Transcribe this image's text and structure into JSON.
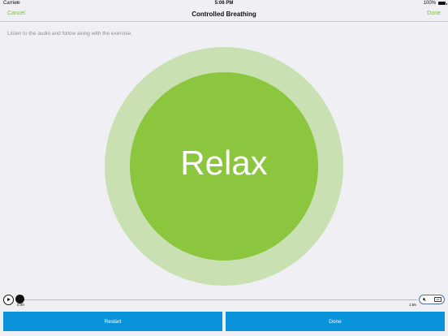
{
  "status_bar": {
    "carrier": "Carrier",
    "wifi_icon": "wifi-icon",
    "time": "5:06 PM",
    "battery": "100%"
  },
  "nav": {
    "cancel_label": "Cancel",
    "title": "Controlled Breathing",
    "done_label": "Done"
  },
  "instruction": "Listen to the audio and follow along with the exercise.",
  "breathing": {
    "word": "Relax",
    "outer_color": "#c9e1b2",
    "inner_color": "#8cc63f"
  },
  "player": {
    "current_time": "0:00",
    "total_time": "1:56",
    "progress": 0.0,
    "mute_icon": "speaker-muted-icon",
    "cc_icon": "closed-captions-icon",
    "cc_text": "CC"
  },
  "buttons": {
    "restart_label": "Restart",
    "done_label": "Done"
  },
  "colors": {
    "accent_green": "#7ac143",
    "button_blue": "#0a93db"
  }
}
